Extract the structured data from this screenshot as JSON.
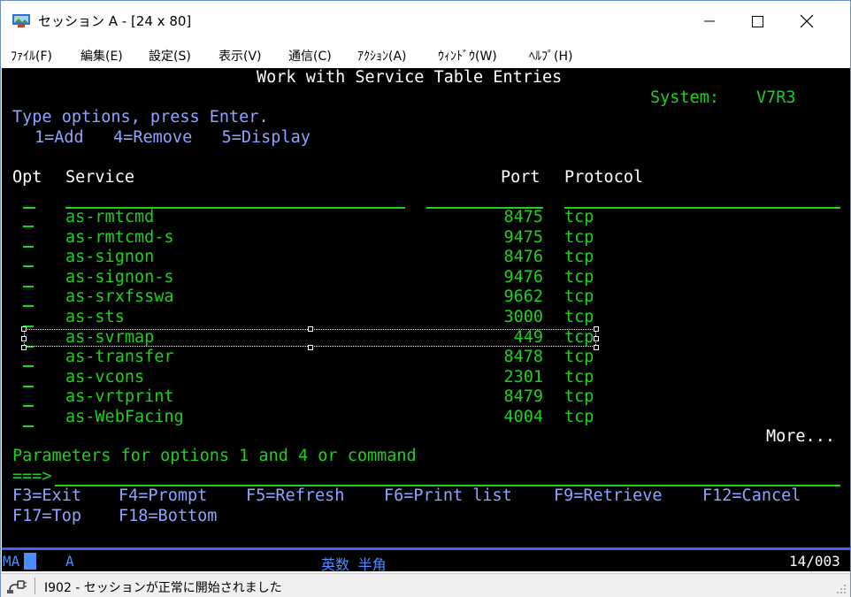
{
  "window": {
    "title": "セッション A - [24 x 80]",
    "icon": "session-emulator-icon",
    "controls": {
      "minimize": "─",
      "maximize": "☐",
      "close": "✕"
    }
  },
  "menu": [
    {
      "label": "ﾌｧｲﾙ(F)"
    },
    {
      "label": "編集(E)"
    },
    {
      "label": "設定(S)"
    },
    {
      "label": "表示(V)"
    },
    {
      "label": "通信(C)"
    },
    {
      "label": "ｱｸｼｮﾝ(A)"
    },
    {
      "label": "ｳｨﾝﾄﾞｳ(W)"
    },
    {
      "label": "ﾍﾙﾌﾟ(H)"
    }
  ],
  "screen": {
    "title": "Work with Service Table Entries",
    "system_label": "System:",
    "system_value": "V7R3",
    "instruction": "Type options, press Enter.",
    "options": "1=Add   4=Remove   5=Display",
    "headers": {
      "opt": "Opt",
      "service": "Service",
      "port": "Port",
      "protocol": "Protocol"
    },
    "rows": [
      {
        "opt": "_",
        "service": "as-rmtcmd",
        "port": "8475",
        "protocol": "tcp"
      },
      {
        "opt": "_",
        "service": "as-rmtcmd-s",
        "port": "9475",
        "protocol": "tcp"
      },
      {
        "opt": "_",
        "service": "as-signon",
        "port": "8476",
        "protocol": "tcp"
      },
      {
        "opt": "_",
        "service": "as-signon-s",
        "port": "9476",
        "protocol": "tcp"
      },
      {
        "opt": "_",
        "service": "as-srxfsswa",
        "port": "9662",
        "protocol": "tcp"
      },
      {
        "opt": "_",
        "service": "as-sts",
        "port": "3000",
        "protocol": "tcp"
      },
      {
        "opt": "_",
        "service": "as-svrmap",
        "port": "449",
        "protocol": "tcp"
      },
      {
        "opt": "_",
        "service": "as-transfer",
        "port": "8478",
        "protocol": "tcp"
      },
      {
        "opt": "_",
        "service": "as-vcons",
        "port": "2301",
        "protocol": "tcp"
      },
      {
        "opt": "_",
        "service": "as-vrtprint",
        "port": "8479",
        "protocol": "tcp"
      },
      {
        "opt": "_",
        "service": "as-WebFacing",
        "port": "4004",
        "protocol": "tcp"
      }
    ],
    "more": "More...",
    "params_prompt": "Parameters for options 1 and 4 or command",
    "cmd_arrow": "===>",
    "fkeys_row1": [
      "F3=Exit",
      "F4=Prompt",
      "F5=Refresh",
      "F6=Print list",
      "F9=Retrieve",
      "F12=Cancel"
    ],
    "fkeys_row2": [
      "F17=Top",
      "F18=Bottom"
    ]
  },
  "oia": {
    "ma": "MA",
    "a": "A",
    "mode": "英数 半角",
    "position": "14/003"
  },
  "status": {
    "icon": "connection-status-icon",
    "message": "I902 - セッションが正常に開始されました"
  },
  "colors": {
    "screen_bg": "#000000",
    "green": "#1ed11e",
    "white": "#ffffff",
    "blue": "#8ea5ff",
    "oia_line": "#3f63ff"
  }
}
